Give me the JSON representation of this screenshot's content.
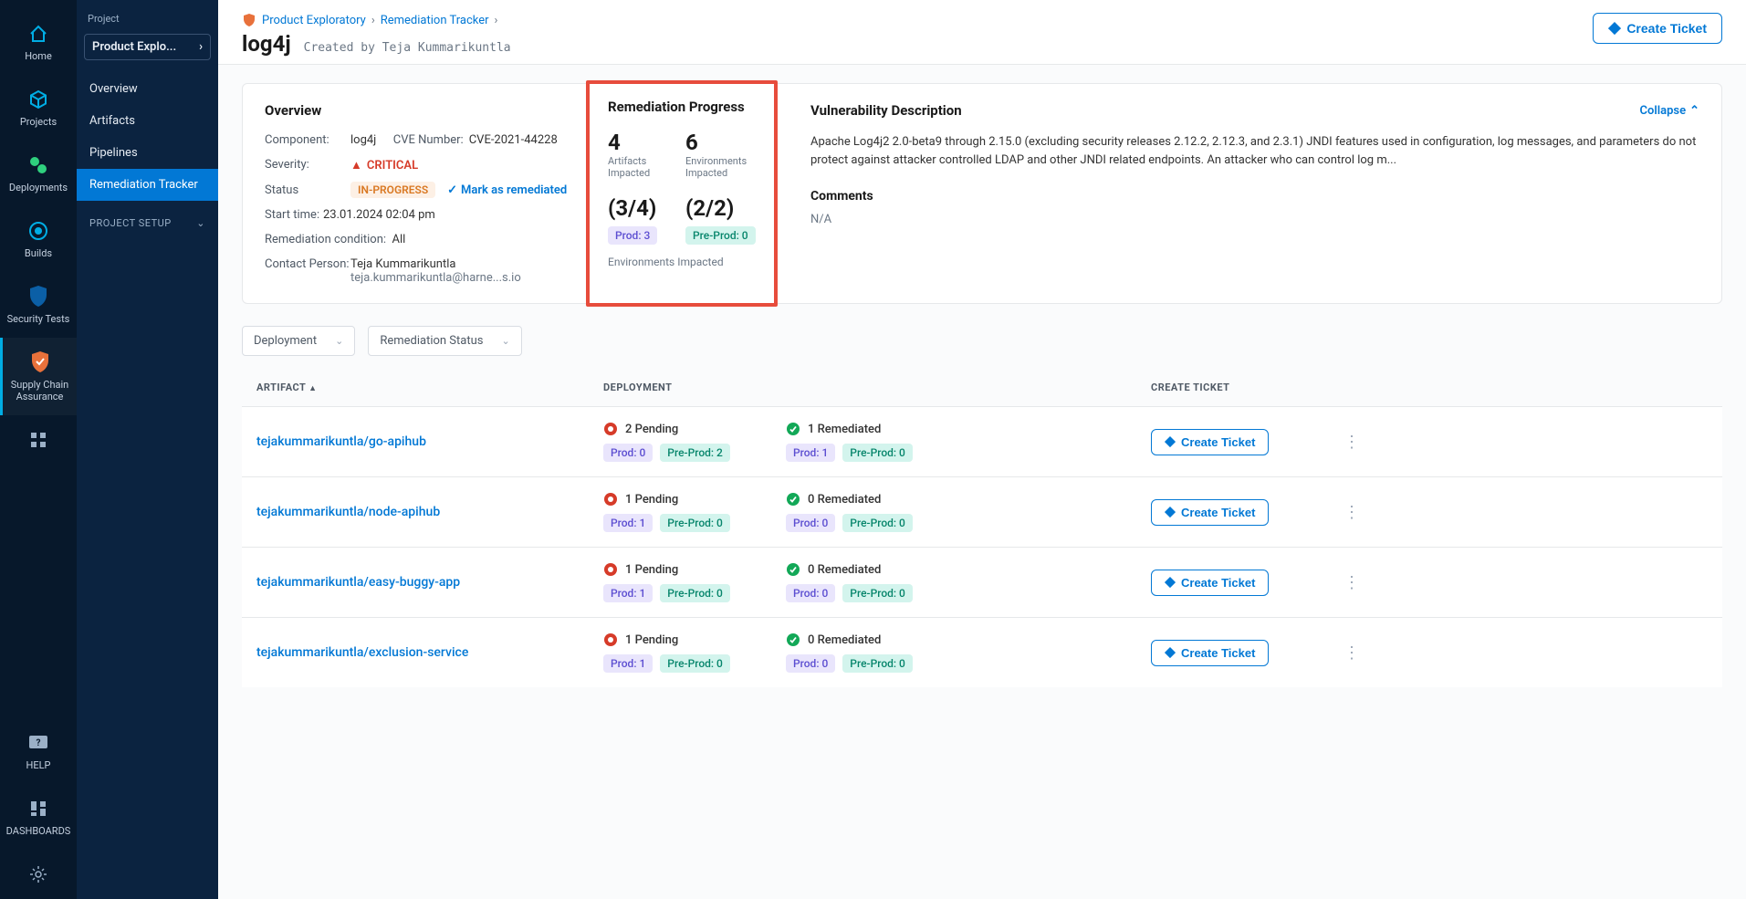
{
  "navRail": [
    {
      "id": "home",
      "label": "Home"
    },
    {
      "id": "projects",
      "label": "Projects"
    },
    {
      "id": "deployments",
      "label": "Deployments"
    },
    {
      "id": "builds",
      "label": "Builds"
    },
    {
      "id": "security",
      "label": "Security Tests"
    },
    {
      "id": "sca",
      "label": "Supply Chain Assurance"
    }
  ],
  "navRailBottom": [
    {
      "id": "help",
      "label": "HELP"
    },
    {
      "id": "dash",
      "label": "DASHBOARDS"
    }
  ],
  "projectHeader": "Project",
  "projectSelector": "Product Explo...",
  "sideLinks": [
    {
      "label": "Overview"
    },
    {
      "label": "Artifacts"
    },
    {
      "label": "Pipelines"
    },
    {
      "label": "Remediation Tracker",
      "active": true
    }
  ],
  "sideGroup": "PROJECT SETUP",
  "breadcrumbs": [
    "Product Exploratory",
    "Remediation Tracker"
  ],
  "page": {
    "title": "log4j",
    "authorPrefix": "Created by",
    "author": "Teja Kummarikuntla",
    "createTicket": "Create Ticket"
  },
  "overview": {
    "heading": "Overview",
    "componentLabel": "Component:",
    "componentValue": "log4j",
    "cveLabel": "CVE Number:",
    "cveValue": "CVE-2021-44228",
    "severityLabel": "Severity:",
    "severityValue": "CRITICAL",
    "statusLabel": "Status",
    "statusValue": "IN-PROGRESS",
    "markRemediated": "Mark as remediated",
    "startTimeLabel": "Start time:",
    "startTimeValue": "23.01.2024 02:04 pm",
    "remedCondLabel": "Remediation condition:",
    "remedCondValue": "All",
    "contactLabel": "Contact Person:",
    "contactName": "Teja Kummarikuntla",
    "contactEmail": "teja.kummarikuntla@harne...s.io"
  },
  "progress": {
    "heading": "Remediation Progress",
    "artifactsCount": "4",
    "artifactsLabel": "Artifacts Impacted",
    "envCount": "6",
    "envLabel": "Environments Impacted",
    "frac1": "(3/4)",
    "prodBadge": "Prod: 3",
    "frac2": "(2/2)",
    "preprodBadge": "Pre-Prod: 0",
    "envImpacted": "Environments Impacted"
  },
  "vuln": {
    "heading": "Vulnerability Description",
    "collapse": "Collapse",
    "body": "Apache Log4j2 2.0-beta9 through 2.15.0 (excluding security releases 2.12.2, 2.12.3, and 2.3.1) JNDI features used in configuration, log messages, and parameters do not protect against attacker controlled LDAP and other JNDI related endpoints. An attacker who can control log m...",
    "commentsHeading": "Comments",
    "commentsValue": "N/A"
  },
  "filters": {
    "deployment": "Deployment",
    "remStatus": "Remediation Status"
  },
  "table": {
    "headers": {
      "artifact": "ARTIFACT",
      "deployment": "DEPLOYMENT",
      "createTicket": "CREATE TICKET"
    },
    "rows": [
      {
        "artifact": "tejakummarikuntla/go-apihub",
        "pending": "2 Pending",
        "pendingProd": "Prod: 0",
        "pendingPre": "Pre-Prod: 2",
        "remediated": "1 Remediated",
        "remProd": "Prod: 1",
        "remPre": "Pre-Prod: 0",
        "ticket": "Create Ticket"
      },
      {
        "artifact": "tejakummarikuntla/node-apihub",
        "pending": "1 Pending",
        "pendingProd": "Prod: 1",
        "pendingPre": "Pre-Prod: 0",
        "remediated": "0 Remediated",
        "remProd": "Prod: 0",
        "remPre": "Pre-Prod: 0",
        "ticket": "Create Ticket"
      },
      {
        "artifact": "tejakummarikuntla/easy-buggy-app",
        "pending": "1 Pending",
        "pendingProd": "Prod: 1",
        "pendingPre": "Pre-Prod: 0",
        "remediated": "0 Remediated",
        "remProd": "Prod: 0",
        "remPre": "Pre-Prod: 0",
        "ticket": "Create Ticket"
      },
      {
        "artifact": "tejakummarikuntla/exclusion-service",
        "pending": "1 Pending",
        "pendingProd": "Prod: 1",
        "pendingPre": "Pre-Prod: 0",
        "remediated": "0 Remediated",
        "remProd": "Prod: 0",
        "remPre": "Pre-Prod: 0",
        "ticket": "Create Ticket"
      }
    ]
  }
}
